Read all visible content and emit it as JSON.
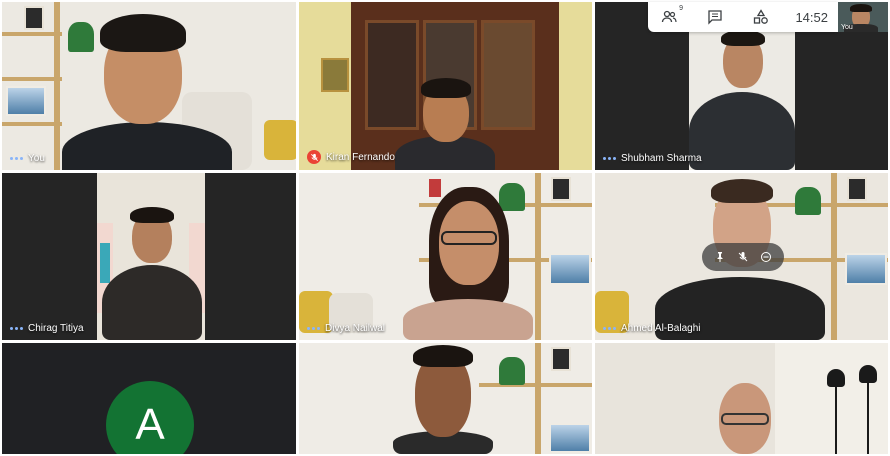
{
  "toolbar": {
    "participants_count": "9",
    "time": "14:52"
  },
  "self_view": {
    "label": "You"
  },
  "tiles": [
    {
      "name": "You",
      "muted": false
    },
    {
      "name": "Kiran Fernando",
      "muted": true
    },
    {
      "name": "Shubham Sharma",
      "muted": false
    },
    {
      "name": "Chirag Titiya",
      "muted": false
    },
    {
      "name": "Divya Nailwal",
      "muted": false
    },
    {
      "name": "Ahmed Al-Balaghi",
      "muted": false
    },
    {
      "name": "",
      "avatar_letter": "A",
      "avatar_color": "#137333"
    },
    {
      "name": ""
    },
    {
      "name": ""
    }
  ],
  "colors": {
    "active_speaker_dots": "#8ab4f8",
    "muted_red": "#ea4335"
  }
}
